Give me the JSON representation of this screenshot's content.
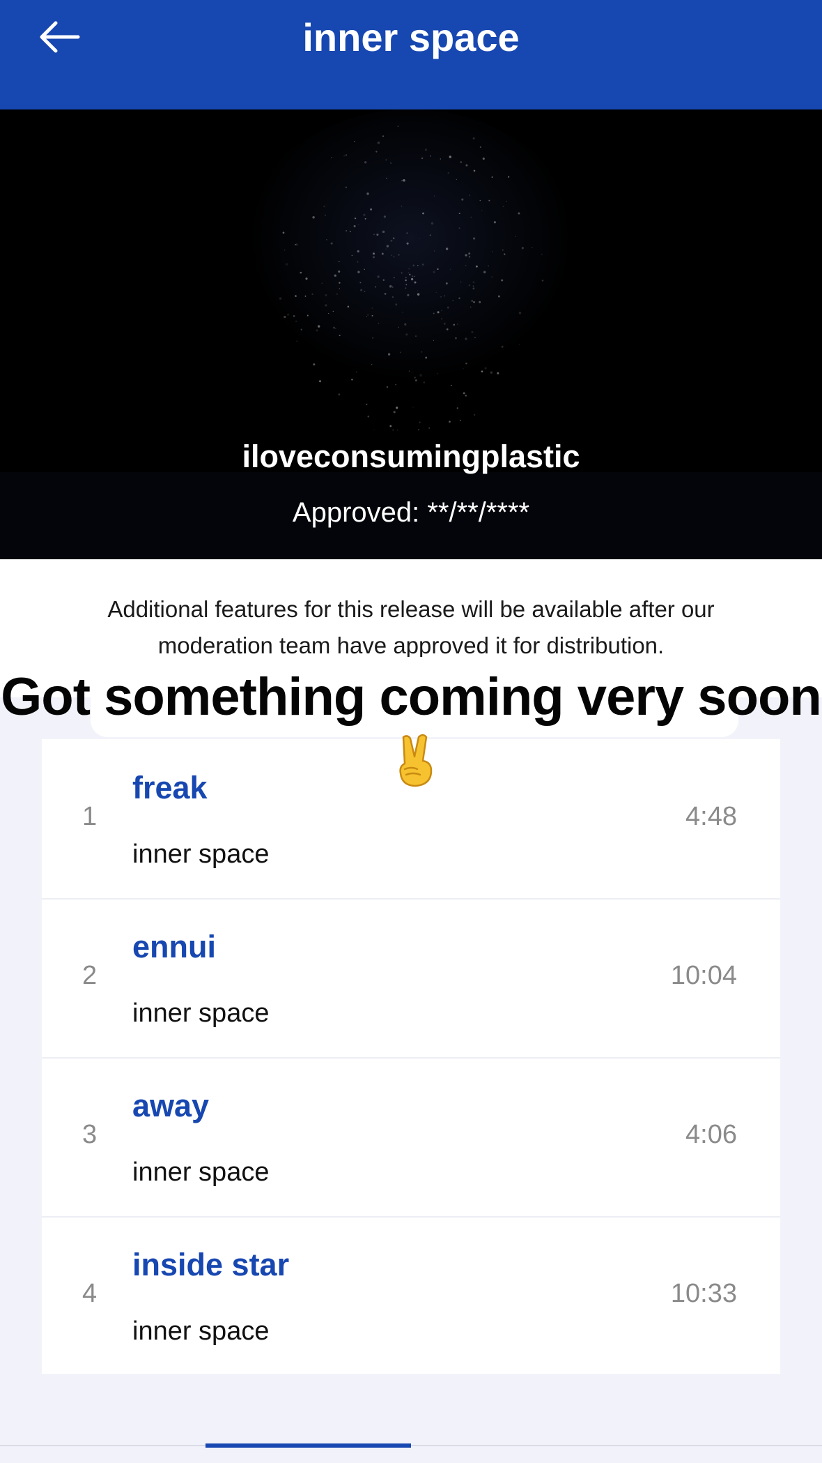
{
  "app_bar": {
    "title": "inner space",
    "back_icon": "arrow-left-icon",
    "color": "#1747b0"
  },
  "hero": {
    "artist": "iloveconsumingplastic",
    "approved": "Approved: **/**/****"
  },
  "notice": {
    "text": "Additional features for this release will be available after our moderation team have approved it for distribution."
  },
  "overlay": {
    "text": "Got something coming very soon",
    "emoji_icon": "victory-hand-emoji"
  },
  "tracks": [
    {
      "number": "1",
      "title": "freak",
      "album": "inner space",
      "duration": "4:48"
    },
    {
      "number": "2",
      "title": "ennui",
      "album": "inner space",
      "duration": "10:04"
    },
    {
      "number": "3",
      "title": "away",
      "album": "inner space",
      "duration": "4:06"
    },
    {
      "number": "4",
      "title": "inside star",
      "album": "inner space",
      "duration": "10:33"
    }
  ]
}
